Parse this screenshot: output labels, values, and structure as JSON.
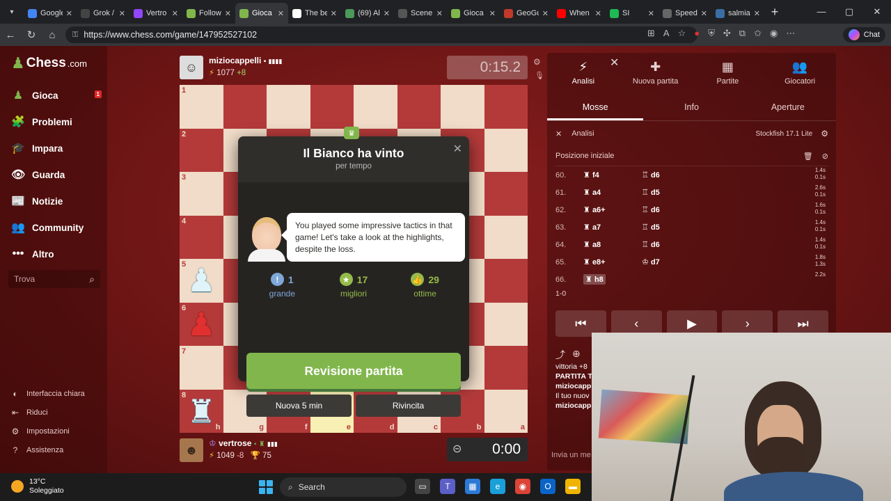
{
  "browser": {
    "tabs": [
      {
        "label": "Google",
        "color": "#4285f4",
        "active": false
      },
      {
        "label": "Grok /",
        "color": "#444444",
        "active": false
      },
      {
        "label": "Vertro",
        "color": "#9146ff",
        "active": false
      },
      {
        "label": "Follow",
        "color": "#81b64c",
        "active": false
      },
      {
        "label": "Gioca",
        "color": "#81b64c",
        "active": true
      },
      {
        "label": "The be",
        "color": "#ffffff",
        "active": false
      },
      {
        "label": "(69) Al",
        "color": "#4a9a5a",
        "active": false
      },
      {
        "label": "Scene",
        "color": "#555555",
        "active": false
      },
      {
        "label": "Gioca",
        "color": "#81b64c",
        "active": false
      },
      {
        "label": "GeoGu",
        "color": "#c0392b",
        "active": false
      },
      {
        "label": "When",
        "color": "#ff0000",
        "active": false
      },
      {
        "label": "SI",
        "color": "#1db954",
        "active": false
      },
      {
        "label": "Speed",
        "color": "#666666",
        "active": false
      },
      {
        "label": "salmia",
        "color": "#3a6ea5",
        "active": false
      }
    ],
    "url": "https://www.chess.com/game/147952527102",
    "chat_label": "Chat"
  },
  "sidebar": {
    "logo_text": "Chess",
    "logo_suffix": ".com",
    "items": [
      {
        "label": "Gioca",
        "icon": "♟",
        "color": "#81b64c",
        "badge": "1"
      },
      {
        "label": "Problemi",
        "icon": "🧩",
        "color": "#f39c12"
      },
      {
        "label": "Impara",
        "icon": "🎓",
        "color": "#3a9ad9"
      },
      {
        "label": "Guarda",
        "icon": "👁",
        "color": "#ffffff"
      },
      {
        "label": "Notizie",
        "icon": "📰",
        "color": "#ffffff"
      },
      {
        "label": "Community",
        "icon": "👥",
        "color": "#5aa0d9"
      },
      {
        "label": "Altro",
        "icon": "•••",
        "color": "#ffffff"
      }
    ],
    "search_placeholder": "Trova",
    "bottom": [
      {
        "label": "Interfaccia chiara",
        "icon": "◐"
      },
      {
        "label": "Riduci",
        "icon": "⇤"
      },
      {
        "label": "Impostazioni",
        "icon": "⚙"
      },
      {
        "label": "Assistenza",
        "icon": "?"
      }
    ]
  },
  "top_player": {
    "name": "miziocappelli",
    "rating": "1077",
    "delta": "+8",
    "clock": "0:15.2"
  },
  "bottom_player": {
    "name": "vertrose",
    "rating": "1049",
    "delta": "-8",
    "trophies": "75",
    "clock": "0:00"
  },
  "board": {
    "ranks": [
      "1",
      "2",
      "3",
      "4",
      "5",
      "6",
      "7",
      "8"
    ],
    "files": [
      "h",
      "g",
      "f",
      "e",
      "d",
      "c",
      "b",
      "a"
    ],
    "pieces": [
      {
        "rank": 5,
        "file": 1,
        "glyph": "♟",
        "color": "white"
      },
      {
        "rank": 6,
        "file": 1,
        "glyph": "♟",
        "color": "red"
      },
      {
        "rank": 8,
        "file": 1,
        "glyph": "♜",
        "color": "white"
      }
    ],
    "highlight": [
      {
        "rank": 8,
        "file": 4
      }
    ]
  },
  "modal": {
    "title": "Il Bianco ha vinto",
    "subtitle": "per tempo",
    "coach_message": "You played some impressive tactics in that game! Let's take a look at the highlights, despite the loss.",
    "stats": [
      {
        "key": "great",
        "icon": "!",
        "value": "1",
        "label": "grande"
      },
      {
        "key": "best",
        "icon": "★",
        "value": "17",
        "label": "migliori"
      },
      {
        "key": "exc",
        "icon": "👍",
        "value": "29",
        "label": "ottime"
      }
    ],
    "review_label": "Revisione partita",
    "new_game_label": "Nuova 5 min",
    "rematch_label": "Rivincita"
  },
  "right_panel": {
    "tabs": [
      {
        "label": "Analisi",
        "icon": "⚡",
        "active": true
      },
      {
        "label": "Nuova partita",
        "icon": "✚",
        "active": false
      },
      {
        "label": "Partite",
        "icon": "▦",
        "active": false
      },
      {
        "label": "Giocatori",
        "icon": "👥",
        "active": false
      }
    ],
    "subtabs": [
      {
        "label": "Mosse",
        "active": true
      },
      {
        "label": "Info",
        "active": false
      },
      {
        "label": "Aperture",
        "active": false
      }
    ],
    "analysis_label": "Analisi",
    "engine_label": "Stockfish 17.1 Lite",
    "start_position_label": "Posizione iniziale",
    "moves": [
      {
        "n": "60.",
        "w": "f4",
        "wp": "♜",
        "b": "d6",
        "bp": "♖",
        "t1": "1.4s",
        "t2": "0.1s"
      },
      {
        "n": "61.",
        "w": "a4",
        "wp": "♜",
        "b": "d5",
        "bp": "♖",
        "t1": "2.6s",
        "t2": "0.1s"
      },
      {
        "n": "62.",
        "w": "a6+",
        "wp": "♜",
        "b": "d6",
        "bp": "♖",
        "t1": "1.6s",
        "t2": "0.1s"
      },
      {
        "n": "63.",
        "w": "a7",
        "wp": "♜",
        "b": "d5",
        "bp": "♖",
        "t1": "1.4s",
        "t2": "0.1s"
      },
      {
        "n": "64.",
        "w": "a8",
        "wp": "♜",
        "b": "d6",
        "bp": "♖",
        "t1": "1.4s",
        "t2": "0.1s"
      },
      {
        "n": "65.",
        "w": "e8+",
        "wp": "♜",
        "b": "d7",
        "bp": "♔",
        "t1": "1.8s",
        "t2": "1.3s"
      },
      {
        "n": "66.",
        "w": "h8",
        "wp": "♜",
        "b": "",
        "bp": "",
        "t1": "2.2s",
        "t2": "",
        "current": true
      }
    ],
    "result": "1-0",
    "chat_lines": [
      {
        "text": "vittoria +8",
        "bold": false
      },
      {
        "text": "PARTITA T",
        "bold": true
      },
      {
        "text": "miziocapp",
        "bold": true
      },
      {
        "text": "Il tuo nuov",
        "bold": false
      },
      {
        "text": "miziocapp",
        "bold": true
      }
    ],
    "chat_placeholder": "Invia un me"
  },
  "taskbar": {
    "temperature": "13°C",
    "condition": "Soleggiato",
    "search_label": "Search",
    "apps": [
      {
        "name": "file-explorer",
        "color": "#444444",
        "glyph": "▭"
      },
      {
        "name": "teams",
        "color": "#5b5fc7",
        "glyph": "T"
      },
      {
        "name": "store",
        "color": "#2d7ad6",
        "glyph": "▦"
      },
      {
        "name": "edge",
        "color": "#1aa0d8",
        "glyph": "e"
      },
      {
        "name": "chrome",
        "color": "#db4437",
        "glyph": "◉"
      },
      {
        "name": "outlook",
        "color": "#0a64c8",
        "glyph": "O"
      },
      {
        "name": "folder",
        "color": "#f0b400",
        "glyph": "▬"
      }
    ]
  }
}
